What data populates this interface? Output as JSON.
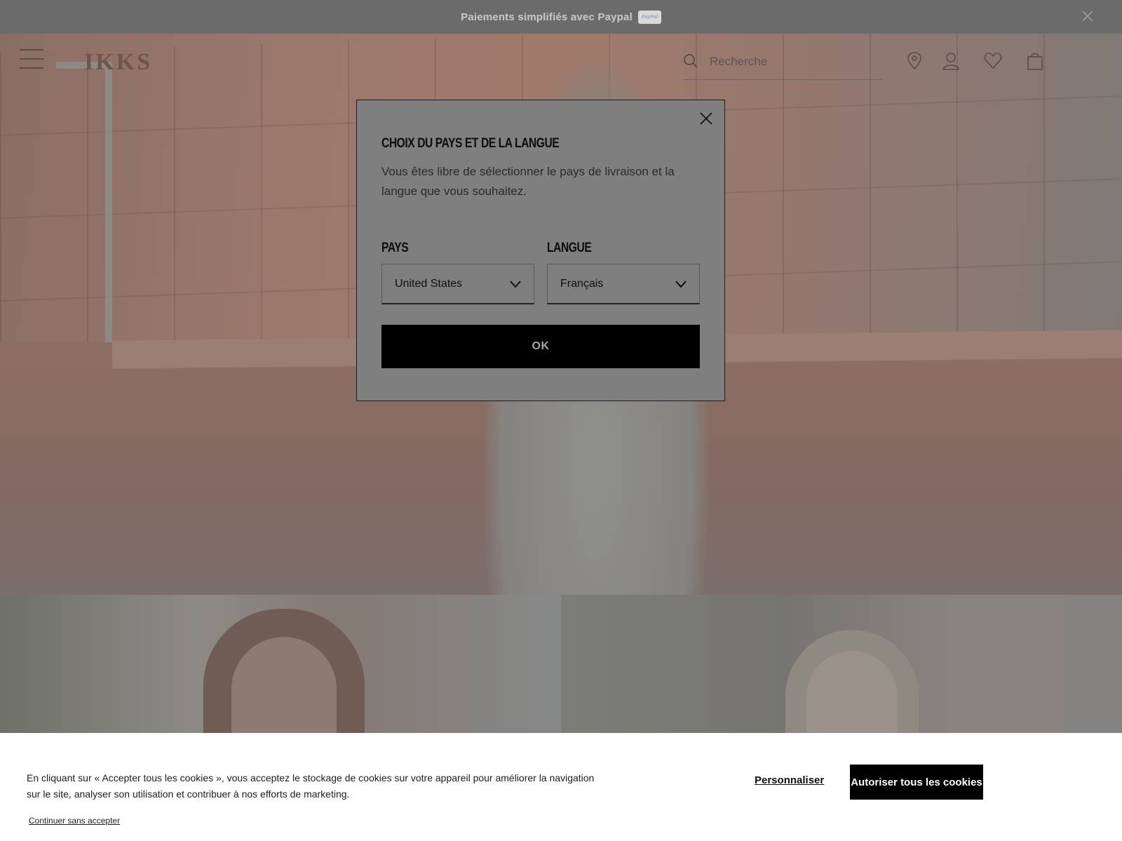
{
  "promo": {
    "text": "Paiements simplifiés avec Paypal",
    "badge": "PayPal",
    "close_icon": "close-icon"
  },
  "header": {
    "logo": "IKKS",
    "search_placeholder": "Recherche",
    "icons": [
      "menu-icon",
      "search-icon",
      "store-locator-icon",
      "account-icon",
      "wishlist-icon",
      "cart-icon"
    ]
  },
  "modal": {
    "title": "Choix du pays et de la langue",
    "description": "Vous êtes libre de sélectionner le pays de livraison et la langue que vous souhaitez.",
    "country_label": "Pays",
    "country_value": "United States",
    "language_label": "Langue",
    "language_value": "Français",
    "ok_label": "OK"
  },
  "cookies": {
    "text": "En cliquant sur « Accepter tous les cookies », vous acceptez le stockage de cookies sur votre appareil pour améliorer la navigation sur le site, analyser son utilisation et contribuer à nos efforts de marketing.",
    "continue_label": "Continuer sans accepter",
    "customize_label": "Personnaliser",
    "accept_label": "Autoriser tous les cookies"
  },
  "colors": {
    "overlay": "#7f7f7f",
    "button_bg": "#000000",
    "banner_bg": "#ffffff"
  }
}
